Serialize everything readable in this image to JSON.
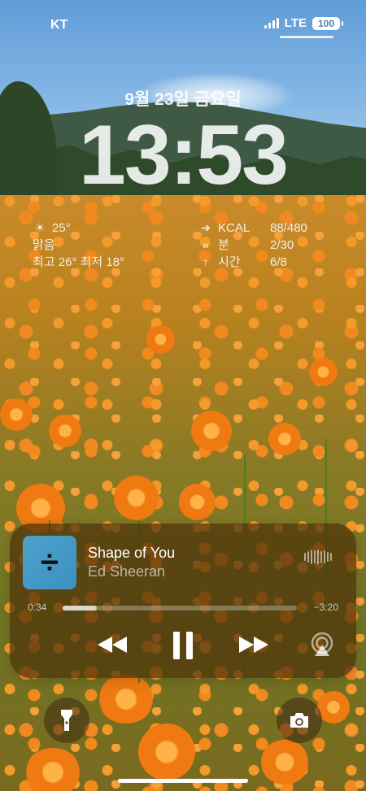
{
  "status": {
    "carrier": "KT",
    "network": "LTE",
    "battery": "100"
  },
  "lock": {
    "date": "9월 23일 금요일",
    "time": "13:53"
  },
  "widgets": {
    "weather": {
      "temperature": "25°",
      "condition": "맑음",
      "range": "최고 26° 최저 18°"
    },
    "activity": [
      {
        "icon": "arrow-right-icon",
        "label": "KCAL",
        "value": "88/480"
      },
      {
        "icon": "double-arrow-icon",
        "label": "분",
        "value": "2/30"
      },
      {
        "icon": "arrow-up-icon",
        "label": "시간",
        "value": "6/8"
      }
    ]
  },
  "now_playing": {
    "title": "Shape of You",
    "artist": "Ed Sheeran",
    "elapsed": "0:34",
    "remaining": "−3:20",
    "progress": 0.145,
    "artwork_glyph": "÷"
  }
}
